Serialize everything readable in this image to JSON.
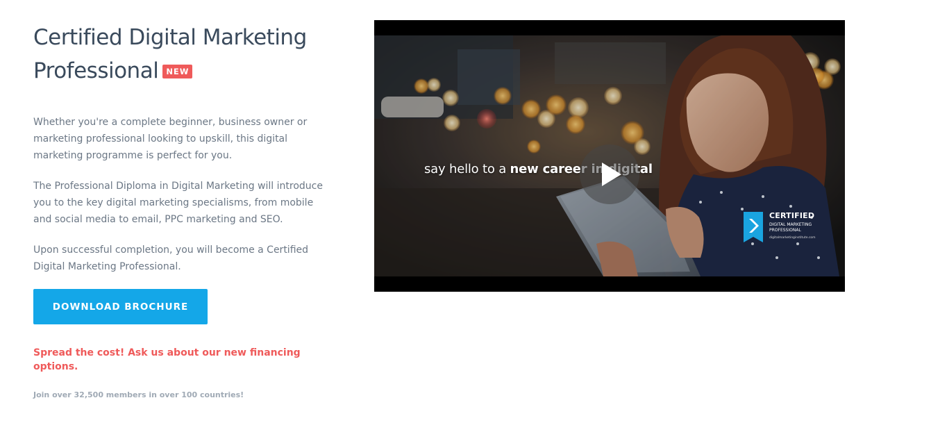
{
  "hero": {
    "title": "Certified Digital Marketing Professional",
    "badge": "NEW",
    "paragraphs": [
      "Whether you're a complete beginner, business owner or marketing professional looking to upskill, this digital marketing programme is perfect for you.",
      "The Professional Diploma in Digital Marketing will introduce you to the key digital marketing specialisms, from mobile and social media to email, PPC marketing and SEO.",
      "Upon successful completion, you will become a Certified Digital Marketing Professional."
    ],
    "cta_label": "DOWNLOAD BROCHURE",
    "promo_text": "Spread the cost! Ask us about our new financing options.",
    "members_text": "Join over 32,500 members in over 100 countries!"
  },
  "video": {
    "caption_light": "say hello to a ",
    "caption_bold": "new career in digital",
    "play_icon": "play-icon",
    "cert_title": "CERTIFIED",
    "cert_subtitle": "DIGITAL MARKETING\nPROFESSIONAL",
    "cert_url": "digitalmarketinginstitute.com"
  },
  "colors": {
    "accent_blue": "#14a7e8",
    "badge_red": "#ef5a5a",
    "title_text": "#3a4a5c",
    "body_text": "#6b7785",
    "muted_text": "#a0aab5"
  }
}
